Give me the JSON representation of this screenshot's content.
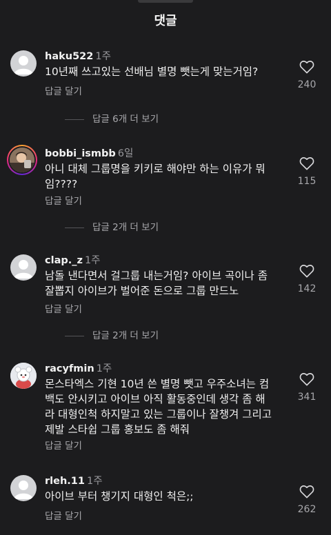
{
  "header": {
    "title": "댓글"
  },
  "reply_label": "답글 달기",
  "comments": [
    {
      "username": "haku522",
      "time": "1주",
      "text": "10년째 쓰고있는 선배님 별명 뺏는게 맞는거임?",
      "likes": "240",
      "view_replies": "답글 6개 더 보기",
      "avatar": "default-avatar"
    },
    {
      "username": "bobbi_ismbb",
      "time": "6일",
      "text": "아니 대체 그룹명을 키키로 해야만 하는 이유가 뭐임????",
      "likes": "115",
      "view_replies": "답글 2개 더 보기",
      "avatar": "photo-avatar-with-story-ring"
    },
    {
      "username": "clap._z",
      "time": "1주",
      "text": "남돌 낸다면서 걸그룹 내는거임? 아이브 곡이나 좀 잘뽑지 아이브가 벌어준 돈으로 그룹 만드노",
      "likes": "142",
      "view_replies": "답글 2개 더 보기",
      "avatar": "default-avatar"
    },
    {
      "username": "racyfmin",
      "time": "1주",
      "text": "몬스타엑스 기현 10년 쓴 별명 뺏고 우주소녀는 컴백도 안시키고 아이브 아직 활동중인데 생각 좀 해라 대형인척 하지말고 있는 그룹이나 잘챙겨 그리고 제발 스타쉽 그룹 홍보도 좀 해줘",
      "likes": "341",
      "avatar": "character-avatar"
    },
    {
      "username": "rleh.11",
      "time": "1주",
      "text": "아이브 부터 챙기지 대형인 척은;;",
      "likes": "262",
      "avatar": "default-avatar"
    }
  ],
  "colors": {
    "background": "#1c1c1e",
    "primary_text": "#f2f2f2",
    "secondary_text": "#a8a8ac"
  }
}
